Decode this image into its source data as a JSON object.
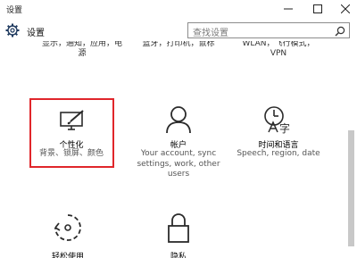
{
  "window": {
    "title": "设置",
    "controls": {
      "minimize": "—",
      "maximize": "☐",
      "close": "✕"
    }
  },
  "header": {
    "title": "设置",
    "search": {
      "placeholder": "查找设置"
    }
  },
  "clipped_row": {
    "item1_line1": "显示，通知，应用，电",
    "item1_line2": "源",
    "item2_line1": "蓝牙，打印机，鼠标",
    "item3_line1": "WLAN，飞行模式，",
    "item3_line2": "VPN"
  },
  "tiles": [
    {
      "name": "个性化",
      "desc": "背景、锁屏、颜色",
      "icon": "personalization-icon",
      "selected": true
    },
    {
      "name": "帐户",
      "desc": "Your account, sync settings, work, other users",
      "icon": "account-icon"
    },
    {
      "name": "时间和语言",
      "desc": "Speech, region, date",
      "icon": "time-language-icon"
    },
    {
      "name": "轻松使用",
      "desc": "",
      "icon": "ease-of-access-icon"
    },
    {
      "name": "隐私",
      "desc": "",
      "icon": "privacy-lock-icon"
    }
  ],
  "colors": {
    "highlight": "#e0262b",
    "accent": "#1f3a5f",
    "icon": "#2b2b2b"
  }
}
